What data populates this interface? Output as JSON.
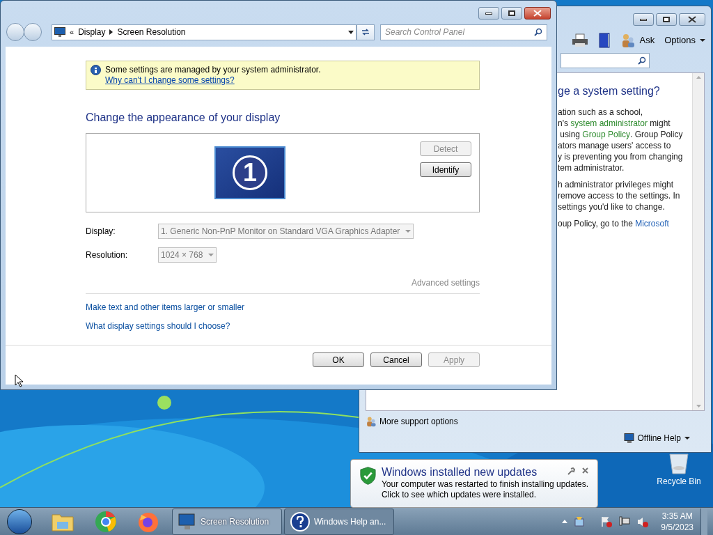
{
  "display_window": {
    "breadcrumb_overflow": "«",
    "breadcrumb": [
      "Display",
      "Screen Resolution"
    ],
    "search": {
      "placeholder": "Search Control Panel"
    },
    "notice": {
      "text": "Some settings are managed by your system administrator.",
      "link": "Why can't I change some settings?"
    },
    "heading": "Change the appearance of your display",
    "monitor_number": "1",
    "monitor_buttons": [
      {
        "label": "Detect",
        "disabled": true
      },
      {
        "label": "Identify",
        "disabled": false
      }
    ],
    "fields": [
      {
        "label": "Display:",
        "value": "1. Generic Non-PnP Monitor on Standard VGA Graphics Adapter",
        "disabled": true
      },
      {
        "label": "Resolution:",
        "value": "1024 × 768",
        "disabled": true
      }
    ],
    "advanced_link": "Advanced settings",
    "links": [
      "Make text and other items larger or smaller",
      "What display settings should I choose?"
    ],
    "buttons": [
      {
        "label": "OK",
        "disabled": false
      },
      {
        "label": "Cancel",
        "disabled": false
      },
      {
        "label": "Apply",
        "disabled": true
      }
    ]
  },
  "help_window": {
    "toolbar": [
      "Ask",
      "Options"
    ],
    "heading": "ge a system setting?",
    "paragraphs": [
      [
        [
          {
            "kind": "text",
            "text": "ation such as a school,"
          }
        ],
        [
          {
            "kind": "text",
            "text": "n's "
          },
          {
            "kind": "term",
            "text": "system administrator"
          },
          {
            "kind": "text",
            "text": " might"
          }
        ],
        [
          {
            "kind": "text",
            "text": " using "
          },
          {
            "kind": "term",
            "text": "Group Policy"
          },
          {
            "kind": "text",
            "text": ". Group Policy"
          }
        ],
        [
          {
            "kind": "text",
            "text": "ators manage users' access to"
          }
        ],
        [
          {
            "kind": "text",
            "text": "y is preventing you from changing"
          }
        ],
        [
          {
            "kind": "text",
            "text": "tem administrator."
          }
        ]
      ],
      [
        [
          {
            "kind": "text",
            "text": "h administrator privileges might"
          }
        ],
        [
          {
            "kind": "text",
            "text": "remove access to the settings. In"
          }
        ],
        [
          {
            "kind": "text",
            "text": "settings you'd like to change."
          }
        ]
      ],
      [
        [
          {
            "kind": "text",
            "text": "oup Policy, go to the "
          },
          {
            "kind": "link",
            "text": "Microsoft"
          }
        ]
      ]
    ],
    "support": "More support options",
    "offline": "Offline Help"
  },
  "notification": {
    "title": "Windows installed new updates",
    "lines": [
      "Your computer was restarted to finish installing updates.",
      "Click to see which updates were installed."
    ]
  },
  "desktop_icons": [
    "Recycle Bin"
  ],
  "taskbar": {
    "tasks": [
      {
        "label": "Screen Resolution",
        "selected": true
      },
      {
        "label": "Windows Help an...",
        "selected": false
      }
    ],
    "time": "3:35 AM",
    "date": "9/5/2023"
  }
}
